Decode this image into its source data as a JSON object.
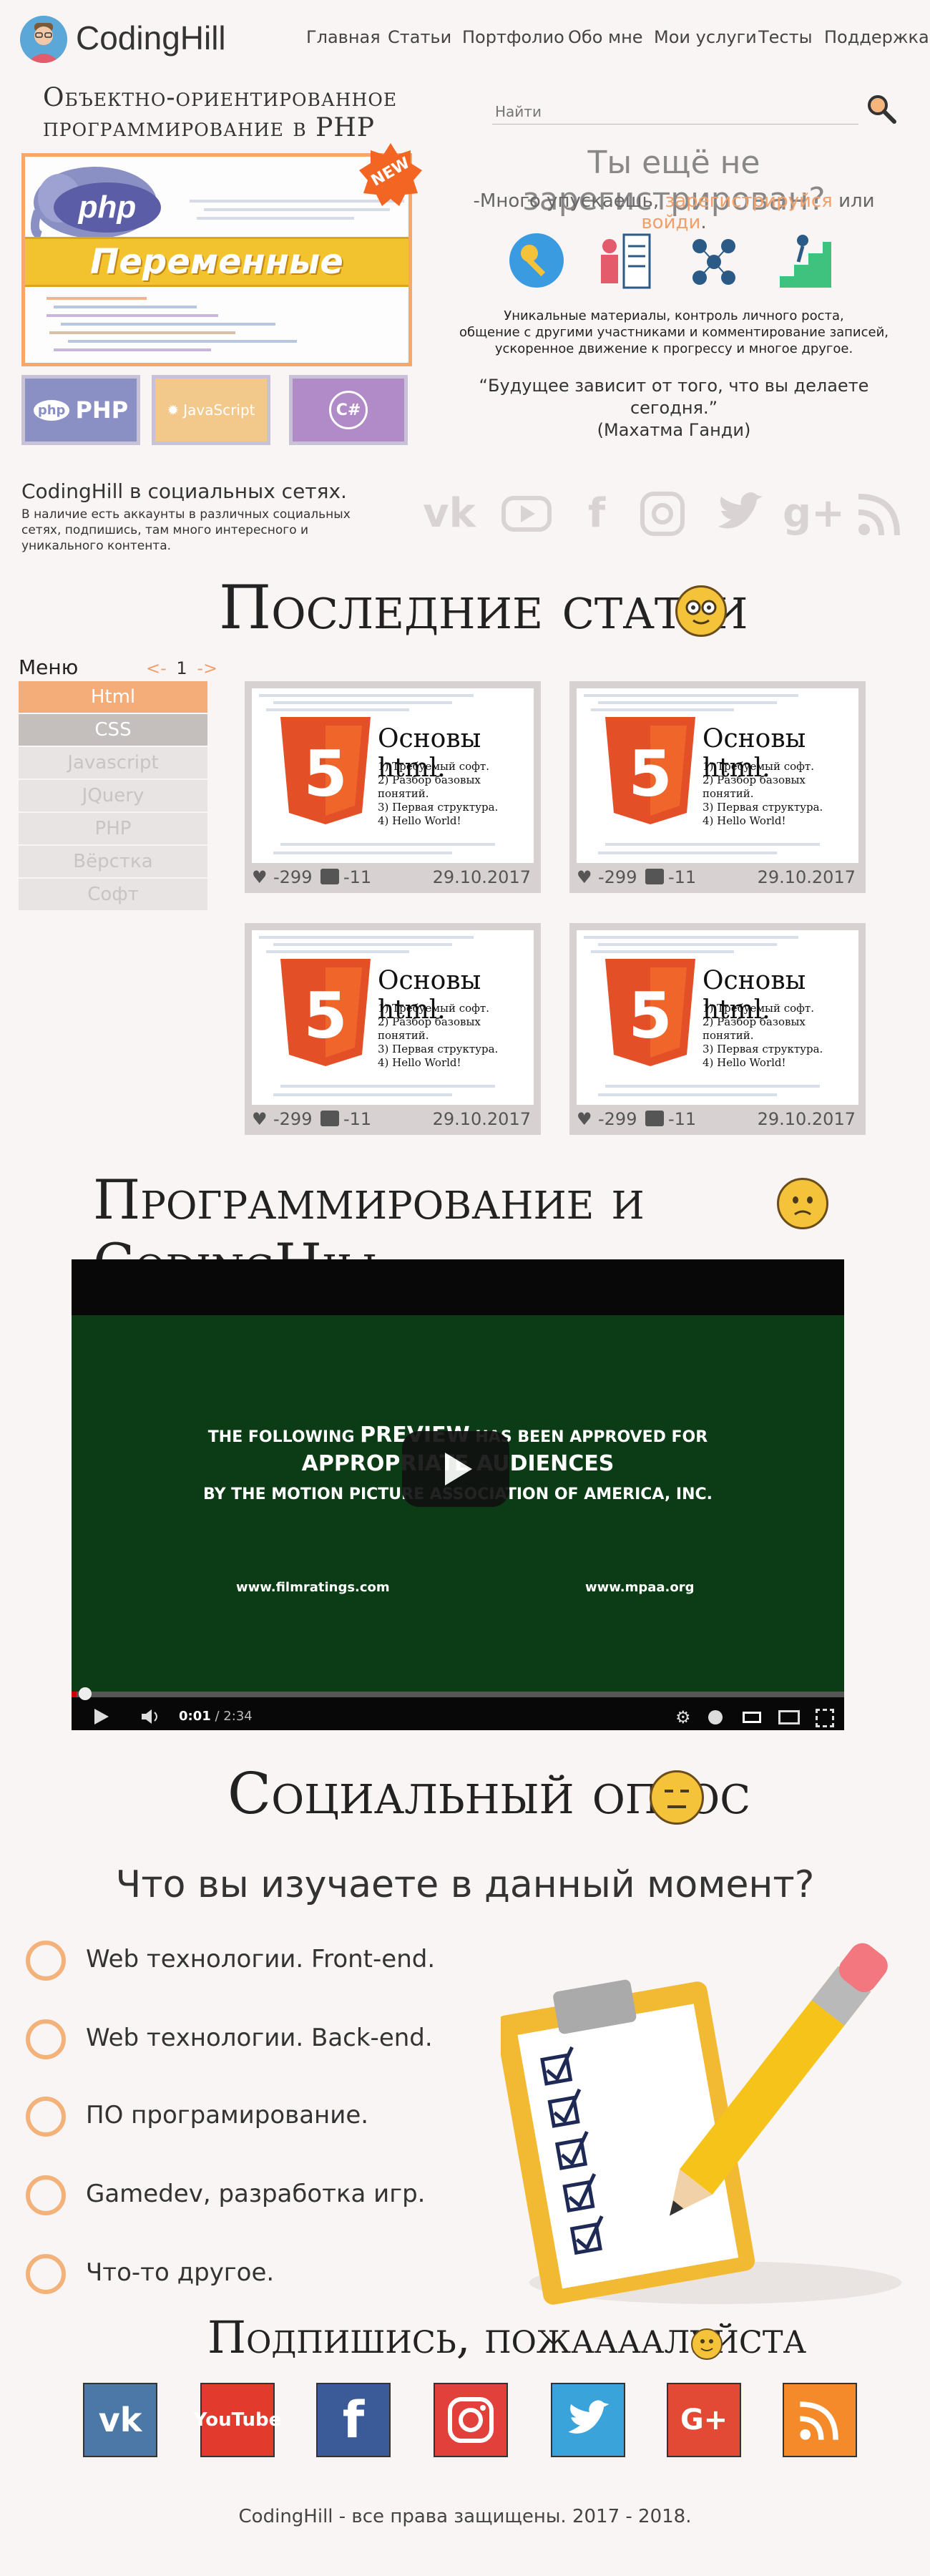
{
  "header": {
    "logo": "CodingHill",
    "nav": [
      "Главная",
      "Статьи",
      "Портфолио",
      "Обо мне",
      "Мои услуги",
      "Тесты",
      "Поддержка"
    ]
  },
  "search": {
    "placeholder": "Найти"
  },
  "course": {
    "title_line1": "Объектно-ориентированное",
    "title_line2": "программирование в PHP",
    "badge": "NEW",
    "banner_logo": "php",
    "banner_label": "Переменные",
    "lang_buttons": [
      "PHP",
      "JavaScript",
      "C#"
    ]
  },
  "register": {
    "title": "Ты ещё не зарегистрирован?",
    "sub_prefix": "-Много упускаешь,",
    "sub_link1": "зарегистрируйся",
    "sub_or": "или",
    "sub_link2": "войди",
    "features_line1": "Уникальные материалы, контроль личного роста,",
    "features_line2": "общение с другими участниками и комментирование записей,",
    "features_line3": "ускоренное движение к прогрессу и многое другое.",
    "quote": "“Будущее зависит от того, что вы делаете сегодня.”",
    "quote_author": "(Махатма Ганди)"
  },
  "social": {
    "title": "CodingHill в социальных сетях.",
    "desc": "В наличие есть аккаунты в различных социальных сетях, подпишись, там много интересного и уникального контента.",
    "icons": [
      "vk-icon",
      "youtube-icon",
      "facebook-icon",
      "instagram-icon",
      "twitter-icon",
      "google-plus-icon",
      "rss-icon"
    ]
  },
  "articles": {
    "title": "Последние статьи",
    "menu_label": "Меню",
    "pager_prev": "<-",
    "pager_page": "1",
    "pager_next": "->",
    "menu": [
      "Html",
      "CSS",
      "Javascript",
      "JQuery",
      "PHP",
      "Вёрстка",
      "Софт"
    ],
    "cards": [
      {
        "heading": "Основы html.",
        "items": [
          "1) Требуемый софт.",
          "2) Разбор базовых понятий.",
          "3) Первая структура.",
          "4) Hello World!"
        ],
        "likes": "-299",
        "comments": "-11",
        "date": "29.10.2017"
      },
      {
        "heading": "Основы html.",
        "items": [
          "1) Требуемый софт.",
          "2) Разбор базовых понятий.",
          "3) Первая структура.",
          "4) Hello World!"
        ],
        "likes": "-299",
        "comments": "-11",
        "date": "29.10.2017"
      },
      {
        "heading": "Основы html.",
        "items": [
          "1) Требуемый софт.",
          "2) Разбор базовых понятий.",
          "3) Первая структура.",
          "4) Hello World!"
        ],
        "likes": "-299",
        "comments": "-11",
        "date": "29.10.2017"
      },
      {
        "heading": "Основы html.",
        "items": [
          "1) Требуемый софт.",
          "2) Разбор базовых понятий.",
          "3) Первая структура.",
          "4) Hello World!"
        ],
        "likes": "-299",
        "comments": "-11",
        "date": "29.10.2017"
      }
    ]
  },
  "video_section": {
    "title": "Программирование и CodingHill",
    "line1_a": "THE FOLLOWING",
    "line1_b": "PREVIEW",
    "line1_c": "HAS BEEN APPROVED FOR",
    "line2": "APPROPRIATE AUDIENCES",
    "line3": "BY THE MOTION PICTURE ASSOCIATION OF AMERICA, INC.",
    "url_left": "www.filmratings.com",
    "url_right": "www.mpaa.org",
    "time_current": "0:01",
    "time_total": "/ 2:34",
    "progress": 0.0065
  },
  "poll": {
    "title": "Социальный опрос",
    "question": "Что вы изучаете в данный момент?",
    "options": [
      "Web технологии. Front-end.",
      "Web технологии. Back-end.",
      "ПО програмирование.",
      "Gamedev, разработка игр.",
      "Что-то другое."
    ]
  },
  "subscribe": {
    "title": "Подпишись, пожаааалуйста",
    "icons": [
      "vk-icon",
      "youtube-icon",
      "facebook-icon",
      "instagram-icon",
      "twitter-icon",
      "google-plus-icon",
      "rss-icon"
    ],
    "youtube_label": "YouTube",
    "gplus_label": "G+"
  },
  "footer": {
    "text": "CodingHill - все права защищены. 2017 - 2018."
  }
}
